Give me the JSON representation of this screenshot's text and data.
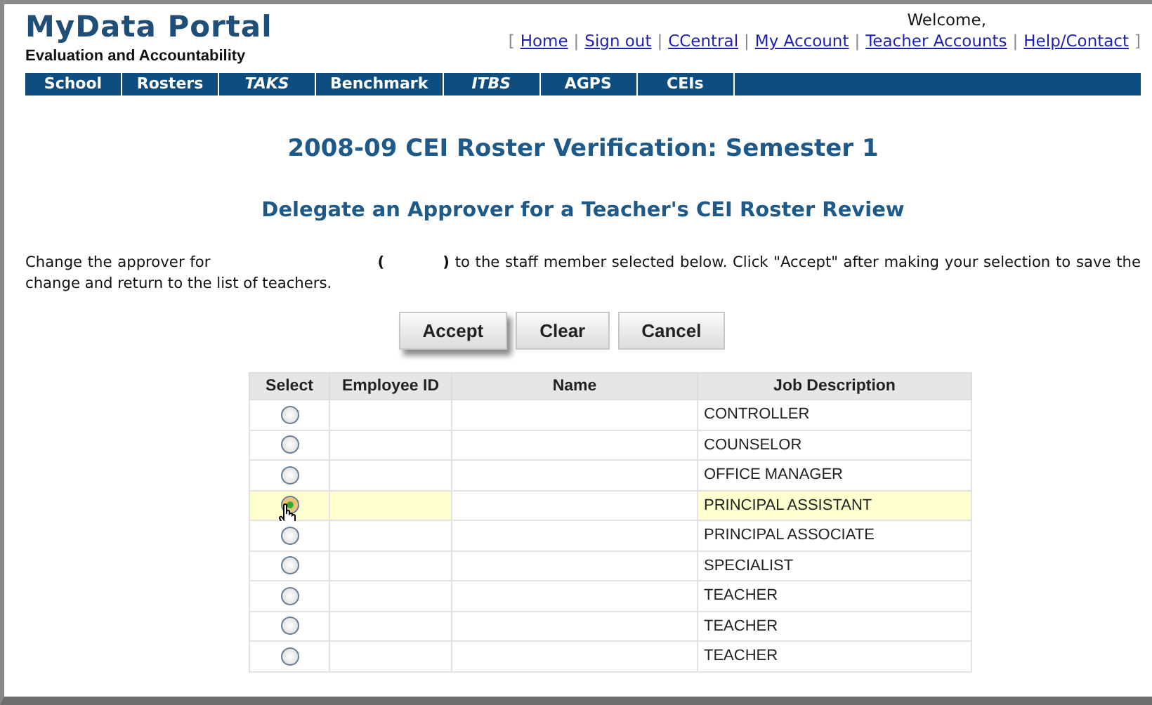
{
  "header": {
    "logo": "MyData Portal",
    "subtitle": "Evaluation and Accountability",
    "welcome": "Welcome,",
    "open_bracket": "[",
    "separator": "|",
    "close_bracket": "]",
    "links": [
      "Home",
      "Sign out",
      "CCentral",
      "My Account",
      "Teacher Accounts",
      "Help/Contact"
    ]
  },
  "nav": [
    {
      "label": "School",
      "italic": false
    },
    {
      "label": "Rosters",
      "italic": false
    },
    {
      "label": "TAKS",
      "italic": true
    },
    {
      "label": "Benchmark",
      "italic": false
    },
    {
      "label": "ITBS",
      "italic": true
    },
    {
      "label": "AGPS",
      "italic": false
    },
    {
      "label": "CEIs",
      "italic": false
    }
  ],
  "title": "2008-09 CEI Roster Verification: Semester 1",
  "subtitle": "Delegate an Approver for a Teacher's CEI Roster Review",
  "instructions": "Change the approver for                               **(          )** to the staff member selected below. Click \"Accept\" after making your selection to save the change and return to the list of teachers.",
  "buttons": [
    {
      "label": "Accept",
      "focused": true
    },
    {
      "label": "Clear",
      "focused": false
    },
    {
      "label": "Cancel",
      "focused": false
    }
  ],
  "table": {
    "columns": [
      "Select",
      "Employee ID",
      "Name",
      "Job Description"
    ],
    "rows": [
      {
        "job": "CONTROLLER",
        "selected": false
      },
      {
        "job": "COUNSELOR",
        "selected": false
      },
      {
        "job": "OFFICE MANAGER",
        "selected": false
      },
      {
        "job": "PRINCIPAL ASSISTANT",
        "selected": true
      },
      {
        "job": "PRINCIPAL ASSOCIATE",
        "selected": false
      },
      {
        "job": "SPECIALIST",
        "selected": false
      },
      {
        "job": "TEACHER",
        "selected": false
      },
      {
        "job": "TEACHER",
        "selected": false
      },
      {
        "job": "TEACHER",
        "selected": false
      }
    ]
  }
}
